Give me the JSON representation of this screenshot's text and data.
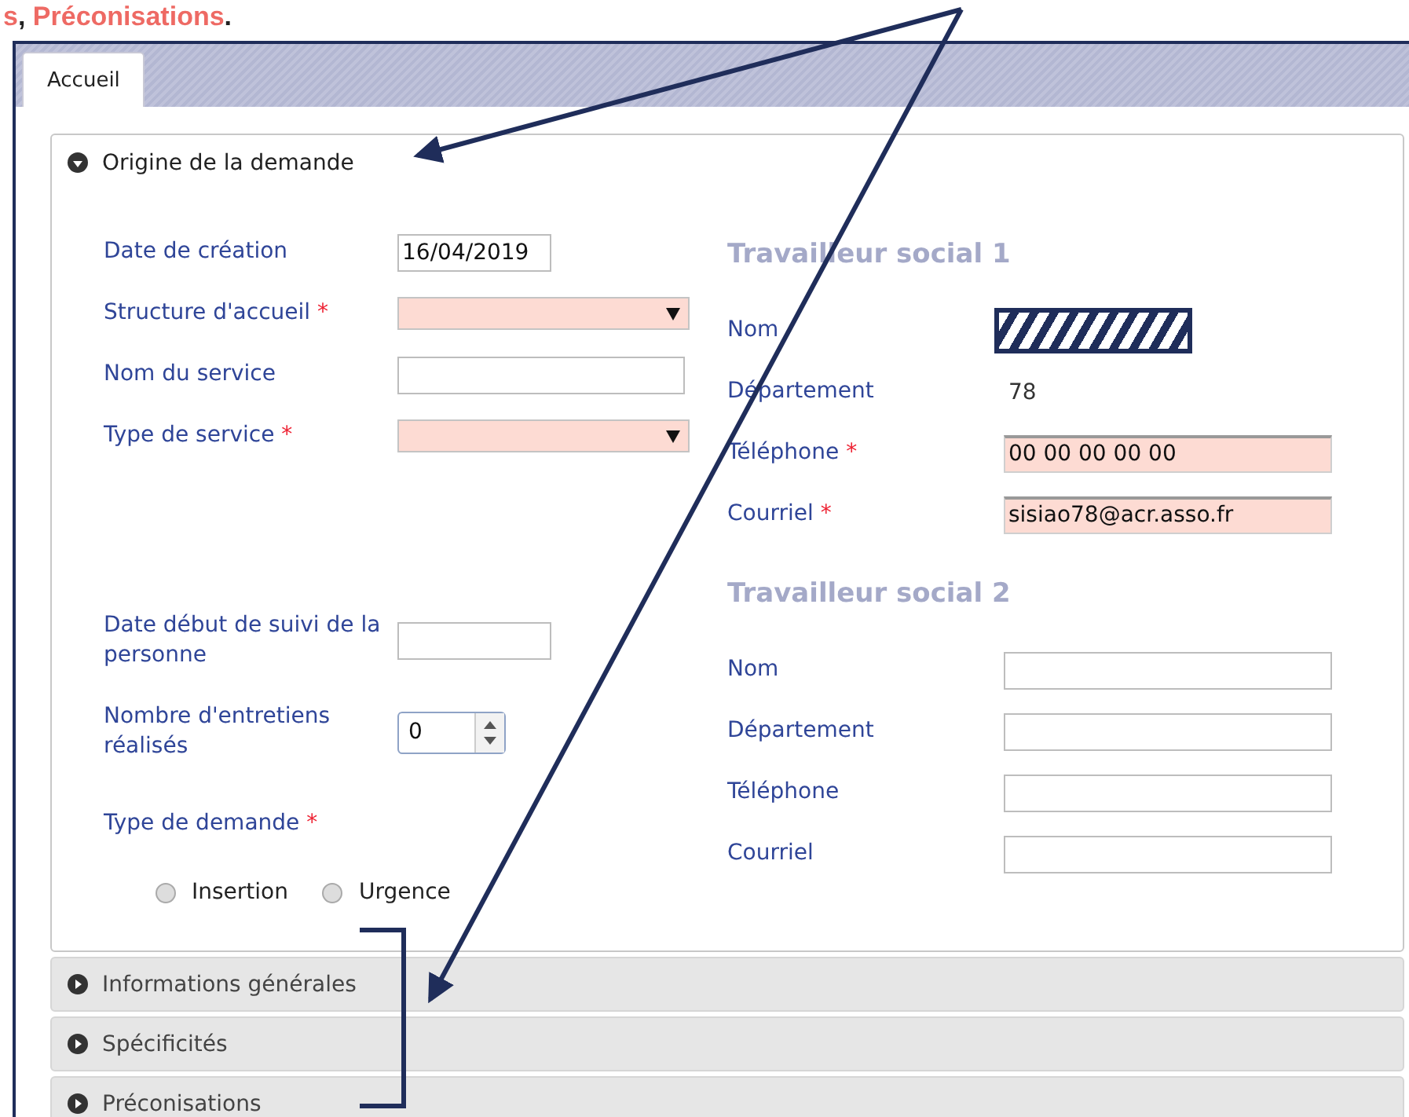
{
  "caption": "**s**, **Préconisations**.",
  "tabs": [
    {
      "label": "Accueil",
      "selected": true
    }
  ],
  "sections": [
    {
      "title": "Origine de la demande",
      "expanded": true
    },
    {
      "title": "Informations générales",
      "expanded": false
    },
    {
      "title": "Spécificités",
      "expanded": false
    },
    {
      "title": "Préconisations",
      "expanded": false
    }
  ],
  "origin": {
    "left_top": [
      {
        "label": "Date de création",
        "kind": "date",
        "value": "16/04/2019"
      },
      {
        "label": "Structure d'accueil",
        "marker": "*",
        "kind": "select",
        "invalid": true
      },
      {
        "label": "Nom du service",
        "kind": "input"
      },
      {
        "label": "Type de service",
        "marker": "*",
        "kind": "select",
        "invalid": true
      }
    ],
    "left_bottom": [
      {
        "label": "Date début de suivi de la personne",
        "kind": "date"
      },
      {
        "label": "Nombre d'entretiens réalisés",
        "kind": "number",
        "value": "0"
      },
      {
        "label": "Type de demande",
        "marker": "*",
        "kind": "radios",
        "options": [
          {
            "label": "Insertion",
            "selected": false
          },
          {
            "label": "Urgence",
            "selected": false
          }
        ]
      }
    ],
    "workers": [
      {
        "title": "Travailleur social 1",
        "fields": [
          {
            "label": "Nom",
            "kind": "redacted"
          },
          {
            "label": "Département",
            "kind": "text",
            "value": "78"
          },
          {
            "label": "Téléphone",
            "marker": "*",
            "kind": "input",
            "value": "00 00 00 00 00",
            "invalid": true
          },
          {
            "label": "Courriel",
            "marker": "*",
            "kind": "input",
            "value": "sisiao78@acr.asso.fr",
            "invalid": true
          }
        ]
      },
      {
        "title": "Travailleur social 2",
        "fields": [
          {
            "label": "Nom",
            "kind": "input"
          },
          {
            "label": "Département",
            "kind": "input"
          },
          {
            "label": "Téléphone",
            "kind": "input"
          },
          {
            "label": "Courriel",
            "kind": "input"
          }
        ]
      }
    ]
  }
}
